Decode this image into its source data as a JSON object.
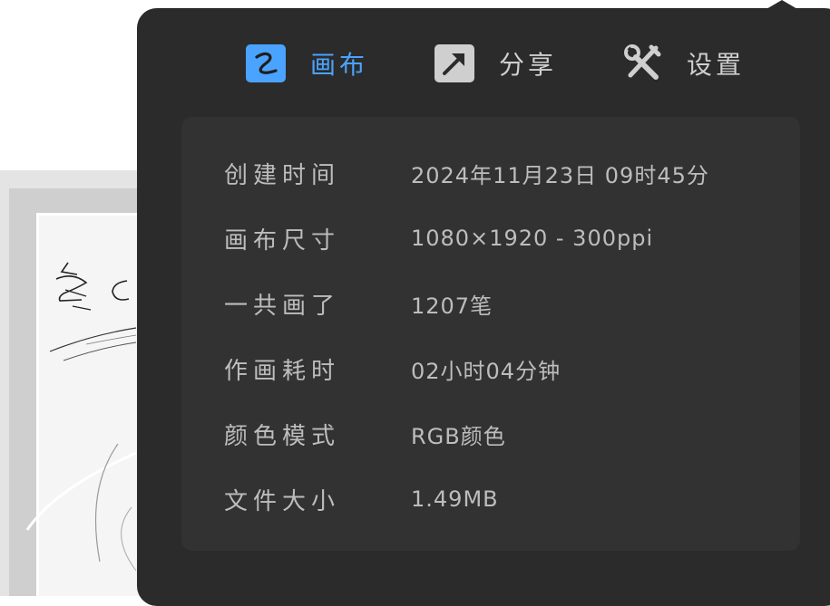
{
  "tabs": [
    {
      "label": "画布",
      "icon": "canvas-curve-icon",
      "active": true
    },
    {
      "label": "分享",
      "icon": "share-arrow-icon",
      "active": false
    },
    {
      "label": "设置",
      "icon": "settings-tools-icon",
      "active": false
    }
  ],
  "info": [
    {
      "label": "创建时间",
      "value": "2024年11月23日 09时45分"
    },
    {
      "label": "画布尺寸",
      "value": "1080×1920 - 300ppi"
    },
    {
      "label": "一共画了",
      "value": "1207笔"
    },
    {
      "label": "作画耗时",
      "value": "02小时04分钟"
    },
    {
      "label": "颜色模式",
      "value": "RGB颜色"
    },
    {
      "label": "文件大小",
      "value": "1.49MB"
    }
  ],
  "colors": {
    "accent": "#4aa3ff",
    "panel": "#2b2b2b",
    "card": "#323232",
    "text": "#bdbdbd"
  }
}
